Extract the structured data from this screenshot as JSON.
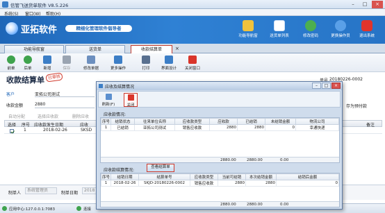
{
  "window": {
    "title": "信管飞送货单软件 V8.5.226"
  },
  "menu": [
    "系统(S)",
    "窗口(W)",
    "帮助(H)"
  ],
  "banner": {
    "brand": "亚拓软件",
    "slogan": "精细化管理软件倡导者",
    "buttons": [
      {
        "label": "功能导航窗",
        "icon": "navigation-icon",
        "color": "#f0c23c"
      },
      {
        "label": "送货单列表",
        "icon": "list-icon",
        "color": "#ffffff"
      },
      {
        "label": "修改密码",
        "icon": "key-icon",
        "color": "#4caf50"
      },
      {
        "label": "更换操作员",
        "icon": "user-icon",
        "color": "#5aa0e8"
      },
      {
        "label": "退出系统",
        "icon": "power-icon",
        "color": "#e0342c"
      }
    ]
  },
  "tabs": [
    {
      "label": "功能导航窗"
    },
    {
      "label": "送货单"
    },
    {
      "label": "收款结算单",
      "active": true
    }
  ],
  "toolbar": [
    {
      "label": "前单",
      "icon": "prev-icon",
      "color": "#3fa34d"
    },
    {
      "label": "后单",
      "icon": "next-icon",
      "color": "#3fa34d"
    },
    {
      "label": "新增",
      "icon": "new-icon",
      "color": "#3c7ec6"
    },
    {
      "label": "保存",
      "icon": "save-icon",
      "color": "#9aa4b1"
    },
    {
      "label": "修改单据",
      "icon": "edit-icon",
      "color": "#6c8fbf"
    },
    {
      "label": "更多操作",
      "icon": "more-icon",
      "color": "#3c7ec6"
    },
    {
      "label": "打印",
      "icon": "print-icon",
      "color": "#59708f"
    },
    {
      "label": "界面设计",
      "icon": "design-icon",
      "color": "#3c7ec6"
    },
    {
      "label": "关闭窗口",
      "icon": "close-window-icon",
      "color": "#d9352a"
    }
  ],
  "doc": {
    "title": "收款结算单",
    "stamp": "已审核",
    "number_label": "单号",
    "number": "20180226-0002",
    "customer_label": "客户",
    "customer": "亚拓公司测试",
    "amount_label": "收款金额",
    "amount": "2880",
    "prepay_label": "存为预付款",
    "actions": [
      "自动分配",
      "选择应收款",
      "删除应收"
    ],
    "grid_headers": [
      "选择",
      "序号",
      "应收款发生日期",
      "应收",
      "备注"
    ],
    "grid_row": {
      "seq": "1",
      "date": "2018-02-26",
      "code": "SKSD"
    },
    "maker_label": "制单人",
    "maker": "系统管理员",
    "make_date_label": "制单日期",
    "make_date": "2018"
  },
  "status": {
    "server": "应用中心:127.0.0.1:7083",
    "conn": "连接"
  },
  "dialog": {
    "title": "应收及结算情况",
    "refresh": "刷新(F)",
    "close": "关闭",
    "receivable_title": "应收款情况:",
    "receivable_headers": [
      "序号",
      "结销状态",
      "往来单位名称",
      "应收款类型",
      "应收款",
      "已结销",
      "未结销金额",
      "物流公司"
    ],
    "receivable_rows": [
      {
        "seq": "1",
        "status": "已结销",
        "company": "亚拓公司测试",
        "type": "销售应收款",
        "amount": "2880",
        "settled": "2880",
        "unsettled": "0",
        "logistics": "幸通快递"
      }
    ],
    "receivable_totals": {
      "amount": "2880.00",
      "settled": "2880.00",
      "unsettled": "0.00"
    },
    "settle_title": "应收款结算情况:",
    "view_button": "查看结算单",
    "settle_headers": [
      "序号",
      "结销日期",
      "结算单号",
      "应收款类型",
      "当前可结销",
      "本次结销金额",
      "结销后金额"
    ],
    "settle_rows": [
      {
        "seq": "1",
        "date": "2018-02-26",
        "number": "SKJD-20180226-0002",
        "type": "销售应收款",
        "current": "2880",
        "this": "2880",
        "after": "0"
      }
    ],
    "settle_totals": {
      "current": "2880.00",
      "this": "2880.00",
      "after": "0.00"
    }
  }
}
